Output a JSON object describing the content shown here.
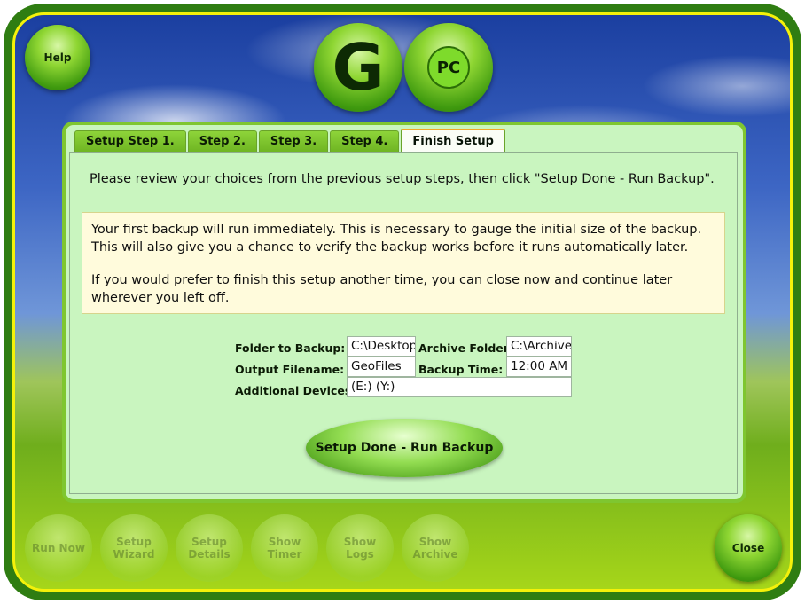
{
  "window": {
    "help_label": "Help",
    "close_label": "Close",
    "logo_letter": "G",
    "logo_pc": "PC"
  },
  "tabs": [
    {
      "label": "Setup Step 1.",
      "active": false
    },
    {
      "label": "Step 2.",
      "active": false
    },
    {
      "label": "Step 3.",
      "active": false
    },
    {
      "label": "Step 4.",
      "active": false
    },
    {
      "label": "Finish Setup",
      "active": true
    }
  ],
  "finish": {
    "intro": "Please review your choices from the previous setup steps, then click \"Setup Done - Run Backup\".",
    "notice_1": "Your first backup will run immediately. This is necessary to gauge the initial size of the backup. This will also give you a chance to verify the backup works before it runs automatically later.",
    "notice_2": "If you would prefer to finish this setup another time, you can close now and continue later wherever you left off.",
    "summary": {
      "folder_label": "Folder to Backup:",
      "folder_value": "C:\\Desktop",
      "archive_label": "Archive Folder:",
      "archive_value": "C:\\Archive",
      "output_label": "Output Filename:",
      "output_value": "GeoFiles",
      "time_label": "Backup Time:",
      "time_value": "12:00 AM",
      "devices_label": "Additional Devices:",
      "devices_value": "(E:) (Y:)"
    },
    "run_button": "Setup Done - Run Backup"
  },
  "bottom_nav": [
    {
      "line1": "Run Now",
      "line2": ""
    },
    {
      "line1": "Setup",
      "line2": "Wizard"
    },
    {
      "line1": "Setup",
      "line2": "Details"
    },
    {
      "line1": "Show",
      "line2": "Timer"
    },
    {
      "line1": "Show",
      "line2": "Logs"
    },
    {
      "line1": "Show",
      "line2": "Archive"
    }
  ],
  "colors": {
    "frame": "#2f7d12",
    "frame_border": "#f4f10a",
    "panel": "#c9f5bf",
    "notice_bg": "#fffbdc",
    "tab_accent": "#f1a72a"
  }
}
